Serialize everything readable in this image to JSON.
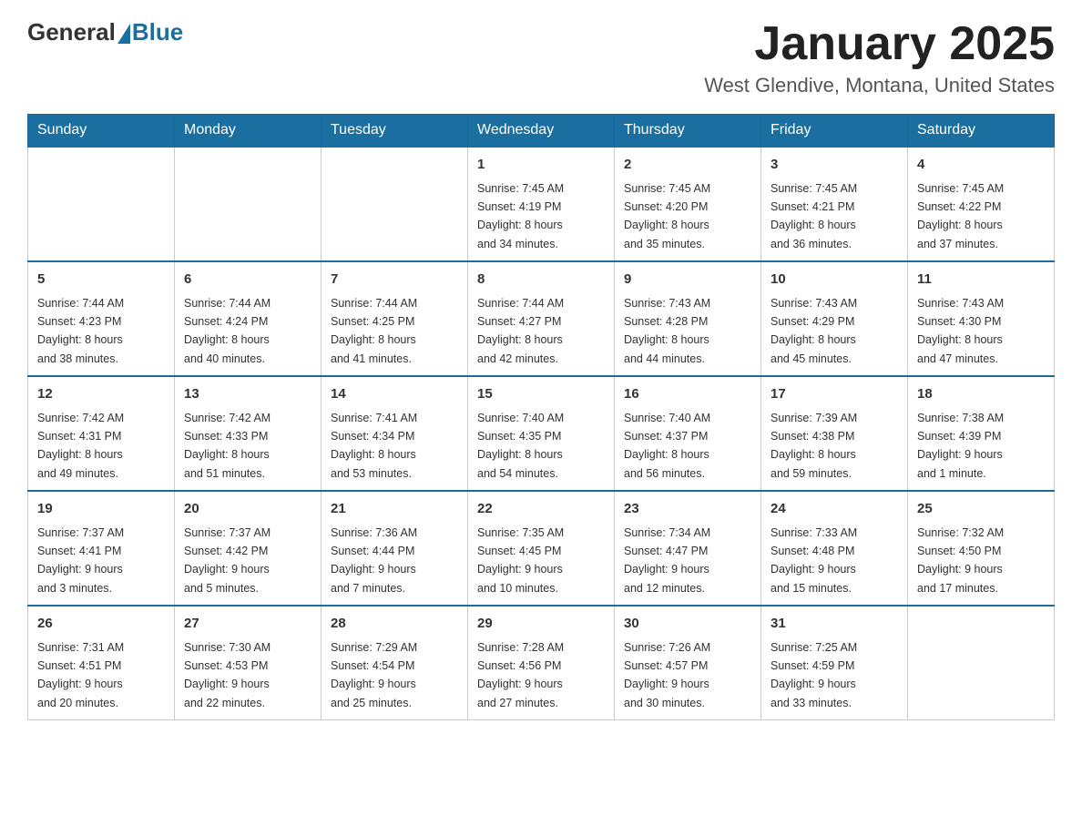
{
  "logo": {
    "text_general": "General",
    "text_blue": "Blue"
  },
  "header": {
    "month_year": "January 2025",
    "location": "West Glendive, Montana, United States"
  },
  "weekdays": [
    "Sunday",
    "Monday",
    "Tuesday",
    "Wednesday",
    "Thursday",
    "Friday",
    "Saturday"
  ],
  "weeks": [
    [
      {
        "day": "",
        "info": ""
      },
      {
        "day": "",
        "info": ""
      },
      {
        "day": "",
        "info": ""
      },
      {
        "day": "1",
        "info": "Sunrise: 7:45 AM\nSunset: 4:19 PM\nDaylight: 8 hours\nand 34 minutes."
      },
      {
        "day": "2",
        "info": "Sunrise: 7:45 AM\nSunset: 4:20 PM\nDaylight: 8 hours\nand 35 minutes."
      },
      {
        "day": "3",
        "info": "Sunrise: 7:45 AM\nSunset: 4:21 PM\nDaylight: 8 hours\nand 36 minutes."
      },
      {
        "day": "4",
        "info": "Sunrise: 7:45 AM\nSunset: 4:22 PM\nDaylight: 8 hours\nand 37 minutes."
      }
    ],
    [
      {
        "day": "5",
        "info": "Sunrise: 7:44 AM\nSunset: 4:23 PM\nDaylight: 8 hours\nand 38 minutes."
      },
      {
        "day": "6",
        "info": "Sunrise: 7:44 AM\nSunset: 4:24 PM\nDaylight: 8 hours\nand 40 minutes."
      },
      {
        "day": "7",
        "info": "Sunrise: 7:44 AM\nSunset: 4:25 PM\nDaylight: 8 hours\nand 41 minutes."
      },
      {
        "day": "8",
        "info": "Sunrise: 7:44 AM\nSunset: 4:27 PM\nDaylight: 8 hours\nand 42 minutes."
      },
      {
        "day": "9",
        "info": "Sunrise: 7:43 AM\nSunset: 4:28 PM\nDaylight: 8 hours\nand 44 minutes."
      },
      {
        "day": "10",
        "info": "Sunrise: 7:43 AM\nSunset: 4:29 PM\nDaylight: 8 hours\nand 45 minutes."
      },
      {
        "day": "11",
        "info": "Sunrise: 7:43 AM\nSunset: 4:30 PM\nDaylight: 8 hours\nand 47 minutes."
      }
    ],
    [
      {
        "day": "12",
        "info": "Sunrise: 7:42 AM\nSunset: 4:31 PM\nDaylight: 8 hours\nand 49 minutes."
      },
      {
        "day": "13",
        "info": "Sunrise: 7:42 AM\nSunset: 4:33 PM\nDaylight: 8 hours\nand 51 minutes."
      },
      {
        "day": "14",
        "info": "Sunrise: 7:41 AM\nSunset: 4:34 PM\nDaylight: 8 hours\nand 53 minutes."
      },
      {
        "day": "15",
        "info": "Sunrise: 7:40 AM\nSunset: 4:35 PM\nDaylight: 8 hours\nand 54 minutes."
      },
      {
        "day": "16",
        "info": "Sunrise: 7:40 AM\nSunset: 4:37 PM\nDaylight: 8 hours\nand 56 minutes."
      },
      {
        "day": "17",
        "info": "Sunrise: 7:39 AM\nSunset: 4:38 PM\nDaylight: 8 hours\nand 59 minutes."
      },
      {
        "day": "18",
        "info": "Sunrise: 7:38 AM\nSunset: 4:39 PM\nDaylight: 9 hours\nand 1 minute."
      }
    ],
    [
      {
        "day": "19",
        "info": "Sunrise: 7:37 AM\nSunset: 4:41 PM\nDaylight: 9 hours\nand 3 minutes."
      },
      {
        "day": "20",
        "info": "Sunrise: 7:37 AM\nSunset: 4:42 PM\nDaylight: 9 hours\nand 5 minutes."
      },
      {
        "day": "21",
        "info": "Sunrise: 7:36 AM\nSunset: 4:44 PM\nDaylight: 9 hours\nand 7 minutes."
      },
      {
        "day": "22",
        "info": "Sunrise: 7:35 AM\nSunset: 4:45 PM\nDaylight: 9 hours\nand 10 minutes."
      },
      {
        "day": "23",
        "info": "Sunrise: 7:34 AM\nSunset: 4:47 PM\nDaylight: 9 hours\nand 12 minutes."
      },
      {
        "day": "24",
        "info": "Sunrise: 7:33 AM\nSunset: 4:48 PM\nDaylight: 9 hours\nand 15 minutes."
      },
      {
        "day": "25",
        "info": "Sunrise: 7:32 AM\nSunset: 4:50 PM\nDaylight: 9 hours\nand 17 minutes."
      }
    ],
    [
      {
        "day": "26",
        "info": "Sunrise: 7:31 AM\nSunset: 4:51 PM\nDaylight: 9 hours\nand 20 minutes."
      },
      {
        "day": "27",
        "info": "Sunrise: 7:30 AM\nSunset: 4:53 PM\nDaylight: 9 hours\nand 22 minutes."
      },
      {
        "day": "28",
        "info": "Sunrise: 7:29 AM\nSunset: 4:54 PM\nDaylight: 9 hours\nand 25 minutes."
      },
      {
        "day": "29",
        "info": "Sunrise: 7:28 AM\nSunset: 4:56 PM\nDaylight: 9 hours\nand 27 minutes."
      },
      {
        "day": "30",
        "info": "Sunrise: 7:26 AM\nSunset: 4:57 PM\nDaylight: 9 hours\nand 30 minutes."
      },
      {
        "day": "31",
        "info": "Sunrise: 7:25 AM\nSunset: 4:59 PM\nDaylight: 9 hours\nand 33 minutes."
      },
      {
        "day": "",
        "info": ""
      }
    ]
  ]
}
